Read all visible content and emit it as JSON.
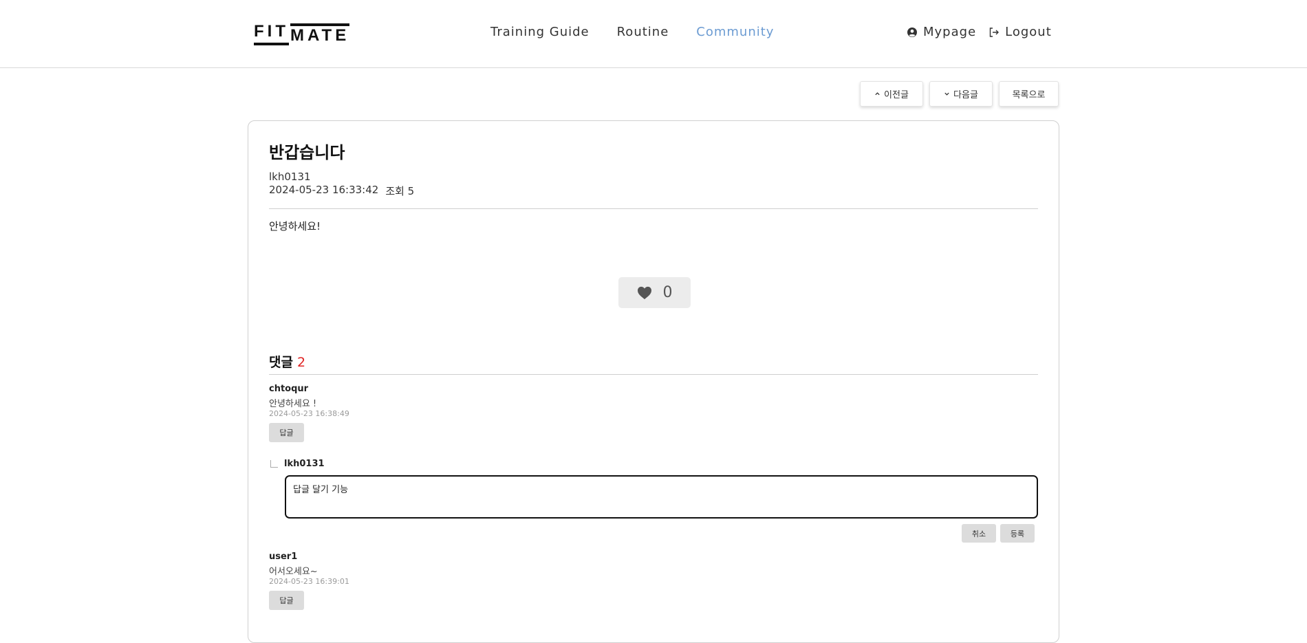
{
  "header": {
    "logo_top": "FIT",
    "logo_bottom": "MATE",
    "nav": [
      {
        "label": "Training Guide"
      },
      {
        "label": "Routine"
      },
      {
        "label": "Community"
      }
    ],
    "mypage_label": "Mypage",
    "logout_label": "Logout",
    "active_color": "#6b9bd2"
  },
  "top_buttons": {
    "prev_label": "이전글",
    "next_label": "다음글",
    "list_label": "목록으로"
  },
  "post": {
    "title": "반갑습니다",
    "author": "lkh0131",
    "datetime": "2024-05-23 16:33:42",
    "views": "조회 5",
    "content": "안녕하세요!",
    "likes": "0"
  },
  "comments": {
    "heading": "댓글",
    "count": "2",
    "items": [
      {
        "user": "chtoqur",
        "text": "안녕하세요 !",
        "date": "2024-05-23 16:38:49",
        "reply_label": "답글"
      },
      {
        "user": "user1",
        "text": "어서오세요~",
        "date": "2024-05-23 16:39:01",
        "reply_label": "답글"
      }
    ],
    "reply_form": {
      "user": "lkh0131",
      "value": "답글 달기 기능",
      "cancel_label": "취소",
      "submit_label": "등록"
    }
  },
  "icons": {
    "mypage": "user-circle-icon",
    "logout": "logout-icon",
    "prev": "chevron-up-icon",
    "next": "chevron-down-icon",
    "like": "heart-icon"
  },
  "colors": {
    "comment_count": "#e02424"
  }
}
